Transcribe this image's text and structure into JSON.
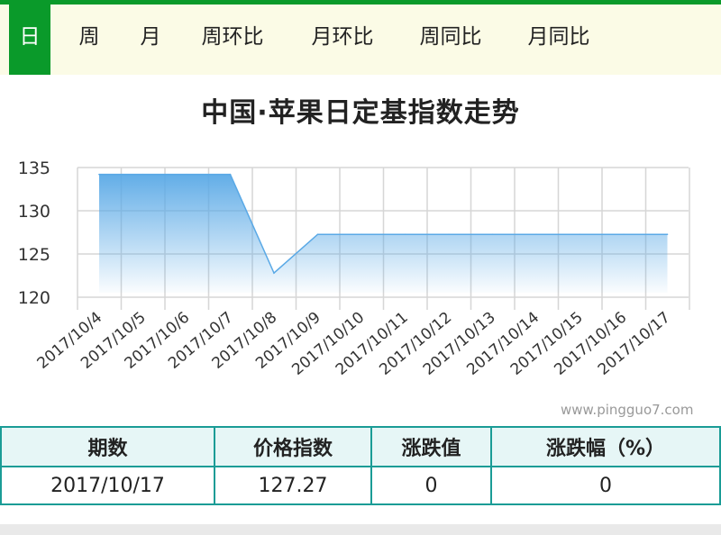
{
  "tabs": [
    {
      "label": "日",
      "active": true
    },
    {
      "label": "周"
    },
    {
      "label": "月"
    },
    {
      "label": "周环比"
    },
    {
      "label": "月环比"
    },
    {
      "label": "周同比"
    },
    {
      "label": "月同比"
    }
  ],
  "watermark": "www.pingguo7.com",
  "colors": {
    "accent": "#0a9a2a",
    "tabbar_bg": "#fbfbe6",
    "table_border": "#1a9c96",
    "series": "#5aa9e6"
  },
  "chart_data": {
    "type": "area",
    "title": "中国·苹果日定基指数走势",
    "x": [
      "2017/10/4",
      "2017/10/5",
      "2017/10/6",
      "2017/10/7",
      "2017/10/8",
      "2017/10/9",
      "2017/10/10",
      "2017/10/11",
      "2017/10/12",
      "2017/10/13",
      "2017/10/14",
      "2017/10/15",
      "2017/10/16",
      "2017/10/17"
    ],
    "series": [
      {
        "values": [
          134.2,
          134.2,
          134.2,
          134.2,
          122.8,
          127.27,
          127.27,
          127.27,
          127.27,
          127.27,
          127.27,
          127.27,
          127.27,
          127.27
        ]
      }
    ],
    "y_ticks": [
      120,
      125,
      130,
      135
    ],
    "ylim": [
      120,
      136
    ],
    "grid": true,
    "legend": "none"
  },
  "table": {
    "headers": [
      "期数",
      "价格指数",
      "涨跌值",
      "涨跌幅（%）"
    ],
    "rows": [
      [
        "2017/10/17",
        "127.27",
        "0",
        "0"
      ]
    ]
  }
}
